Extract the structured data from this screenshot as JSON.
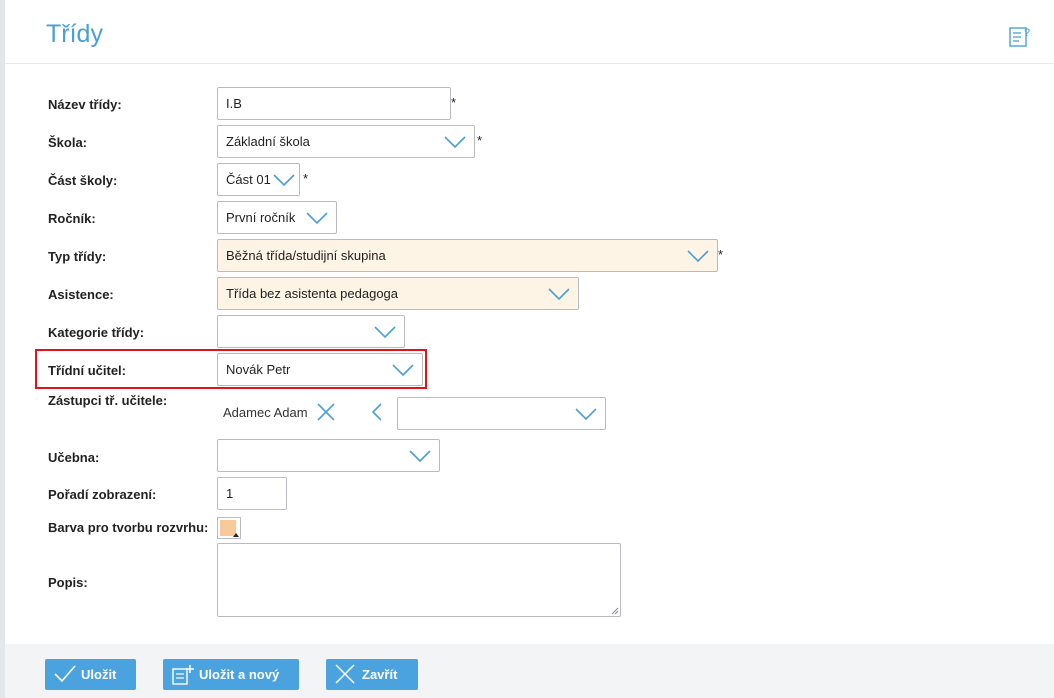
{
  "header": {
    "title": "Třídy",
    "help_icon": "help-document-icon"
  },
  "form": {
    "nazev": {
      "label": "Název třídy:",
      "value": "I.B",
      "required": "*"
    },
    "skola": {
      "label": "Škola:",
      "value": "Základní škola",
      "required": "*"
    },
    "cast": {
      "label": "Část školy:",
      "value": "Část 01",
      "required": "*"
    },
    "rocnik": {
      "label": "Ročník:",
      "value": "První ročník"
    },
    "typ": {
      "label": "Typ třídy:",
      "value": "Běžná třída/studijní skupina",
      "required": "*"
    },
    "asistence": {
      "label": "Asistence:",
      "value": "Třída bez asistenta pedagoga"
    },
    "kategorie": {
      "label": "Kategorie třídy:",
      "value": ""
    },
    "ucitel": {
      "label": "Třídní učitel:",
      "value": "Novák Petr"
    },
    "zastupci": {
      "label": "Zástupci tř. učitele:",
      "selected": [
        "Adamec Adam"
      ],
      "value": ""
    },
    "ucebna": {
      "label": "Učebna:",
      "value": ""
    },
    "poradi": {
      "label": "Pořadí zobrazení:",
      "value": "1"
    },
    "barva": {
      "label": "Barva pro tvorbu rozvrhu:",
      "color": "#f8c99a"
    },
    "popis": {
      "label": "Popis:",
      "value": ""
    }
  },
  "buttons": {
    "save": "Uložit",
    "save_new": "Uložit a nový",
    "close": "Zavřít"
  },
  "colors": {
    "accent": "#4aa3df",
    "highlight_field": "#fef4e6",
    "annotation": "#e0141b"
  }
}
